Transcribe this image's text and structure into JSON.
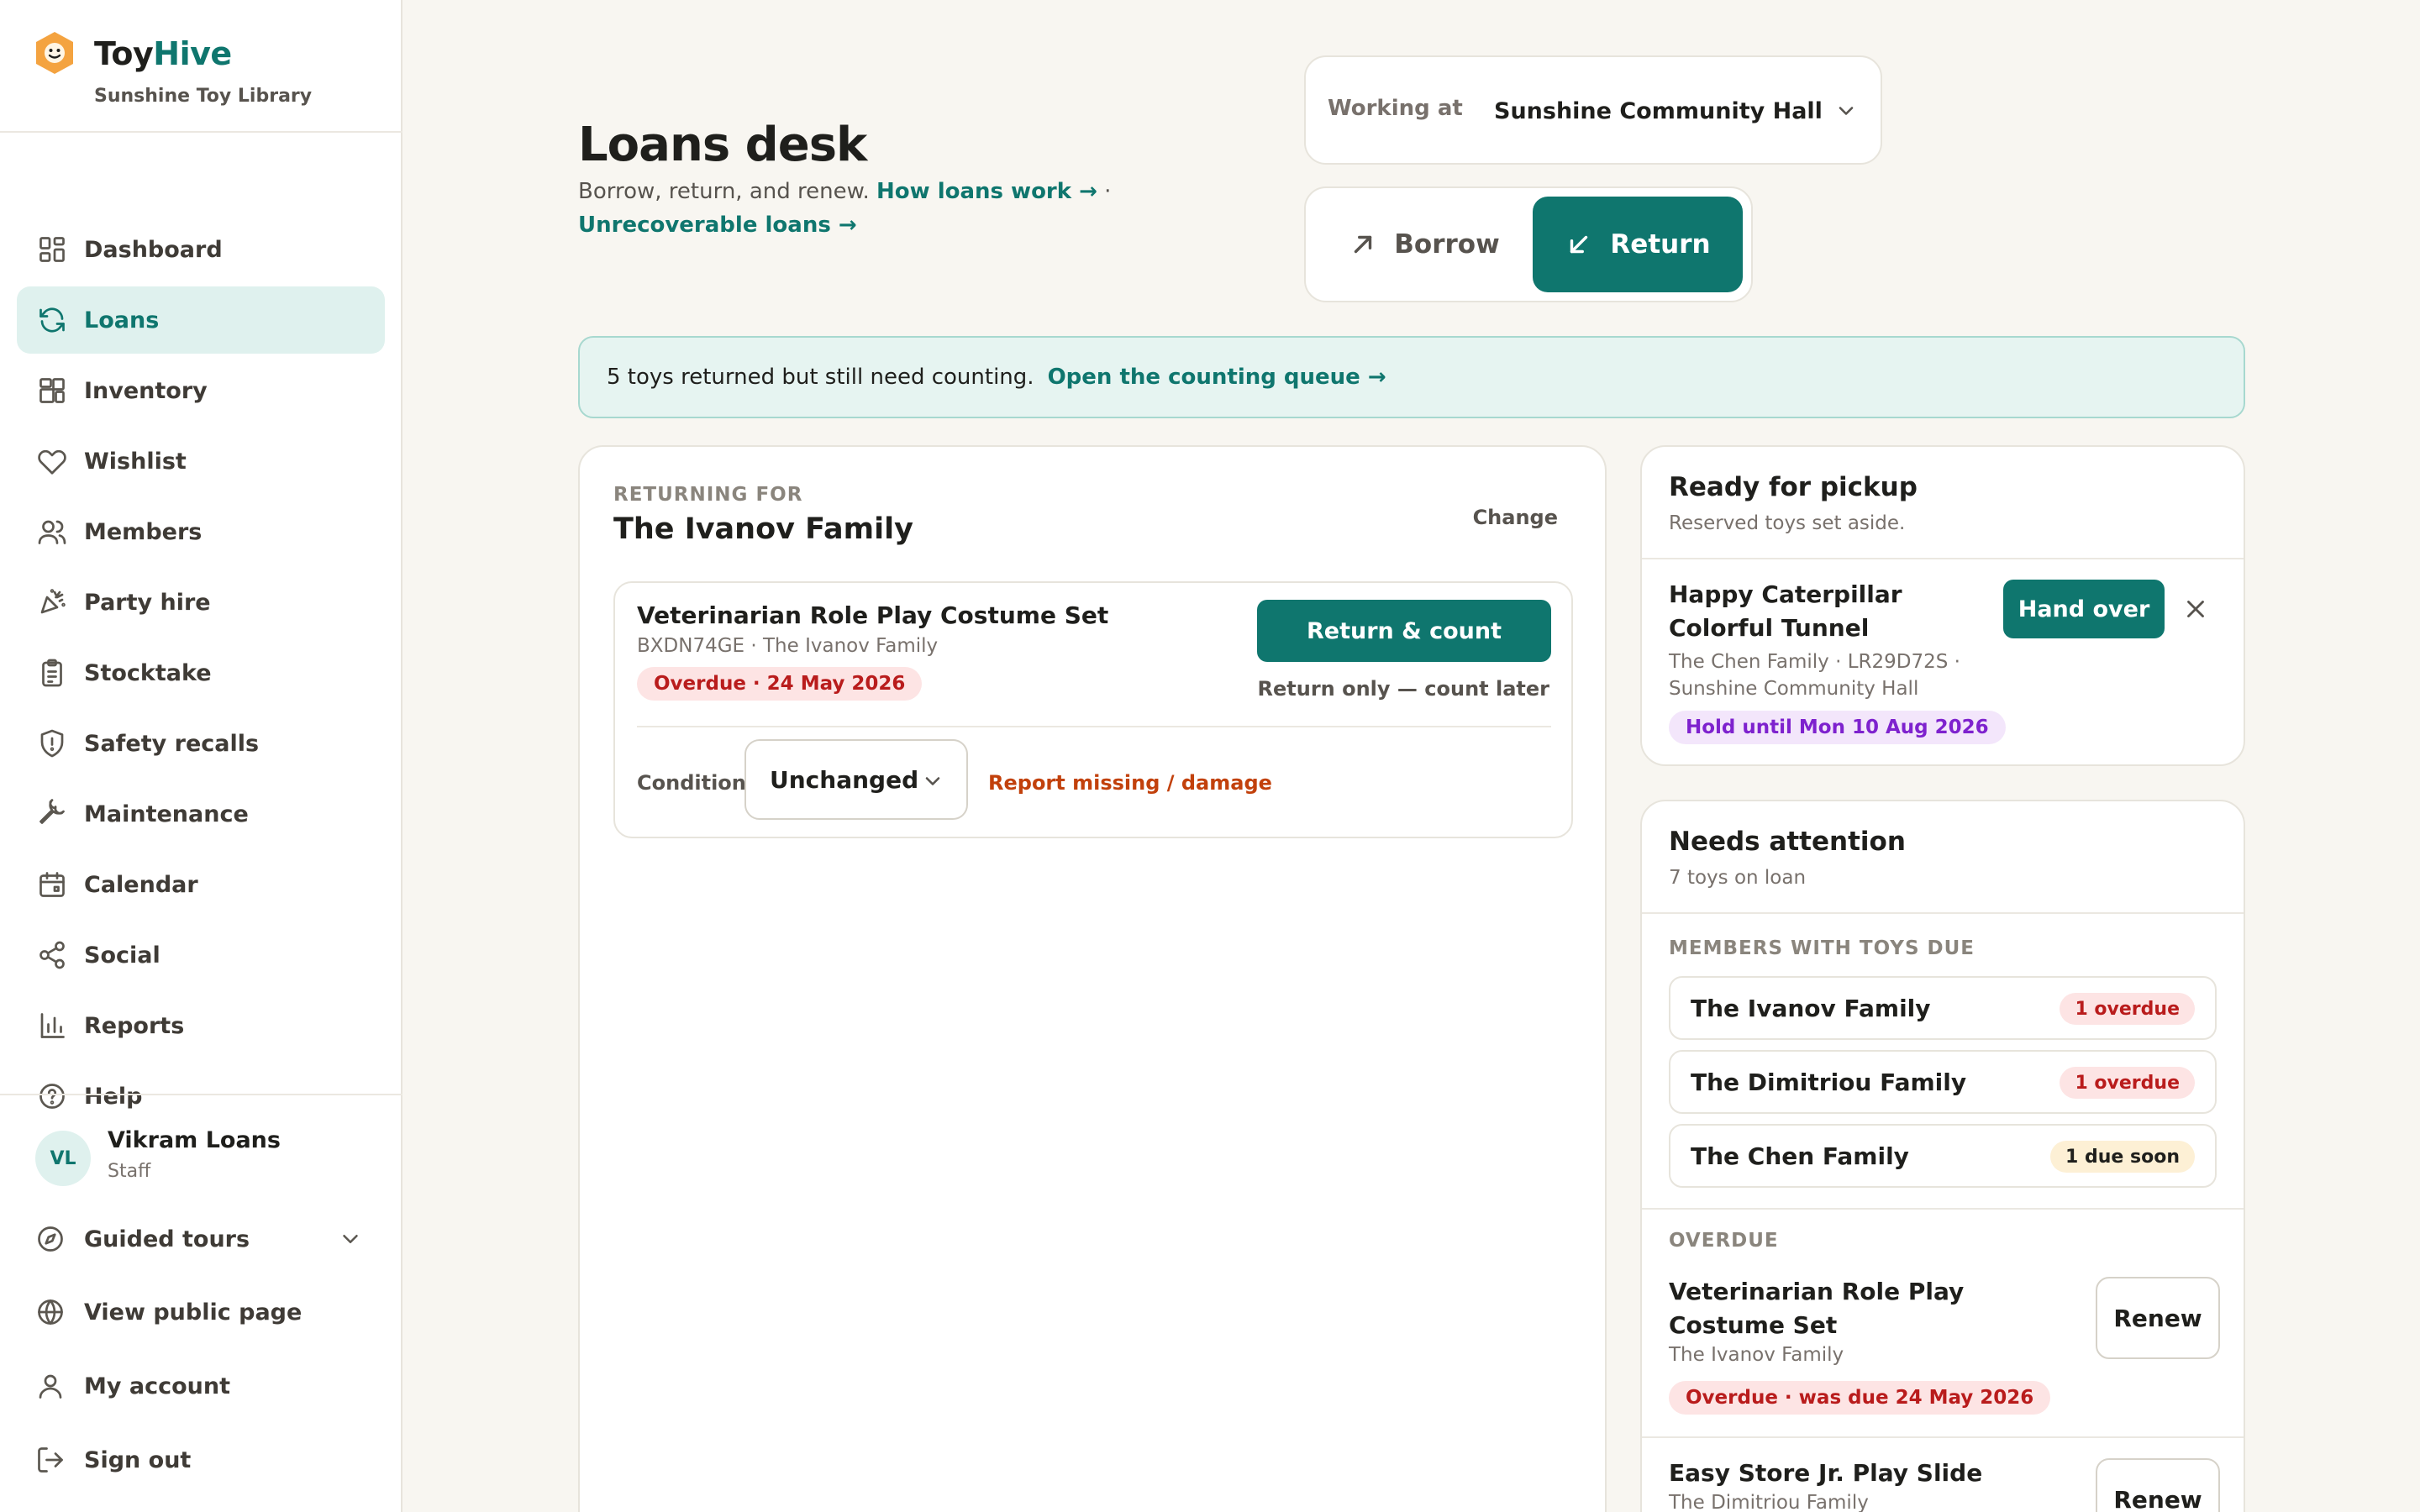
{
  "brand": {
    "name_part1": "Toy",
    "name_part2": "Hive",
    "library": "Sunshine Toy Library"
  },
  "nav": [
    {
      "label": "Dashboard",
      "icon": "dashboard-icon"
    },
    {
      "label": "Loans",
      "icon": "loans-icon",
      "active": true
    },
    {
      "label": "Inventory",
      "icon": "inventory-icon"
    },
    {
      "label": "Wishlist",
      "icon": "heart-icon"
    },
    {
      "label": "Members",
      "icon": "members-icon"
    },
    {
      "label": "Party hire",
      "icon": "party-icon"
    },
    {
      "label": "Stocktake",
      "icon": "clipboard-icon"
    },
    {
      "label": "Safety recalls",
      "icon": "shield-icon"
    },
    {
      "label": "Maintenance",
      "icon": "wrench-icon"
    },
    {
      "label": "Calendar",
      "icon": "calendar-icon"
    },
    {
      "label": "Social",
      "icon": "share-icon"
    },
    {
      "label": "Reports",
      "icon": "chart-icon"
    },
    {
      "label": "Help",
      "icon": "help-icon"
    }
  ],
  "user": {
    "initials": "VL",
    "name": "Vikram Loans",
    "role": "Staff"
  },
  "footer": {
    "guided_tours": "Guided tours",
    "public_page": "View public page",
    "account": "My account",
    "sign_out": "Sign out"
  },
  "header": {
    "title": "Loans desk",
    "subtitle": "Borrow, return, and renew.",
    "link1": "How loans work →",
    "separator": "·",
    "link2": "Unrecoverable loans →"
  },
  "working_at": {
    "label": "Working at",
    "value": "Sunshine Community Hall"
  },
  "mode": {
    "borrow": "Borrow",
    "return": "Return",
    "selected": "Return"
  },
  "banner": {
    "text": "5 toys returned but still need counting.",
    "link": "Open the counting queue →"
  },
  "returning": {
    "eyebrow": "RETURNING FOR",
    "member": "The Ivanov Family",
    "change": "Change",
    "loan": {
      "title": "Veterinarian Role Play Costume Set",
      "meta": "BXDN74GE · The Ivanov Family",
      "status": "Overdue · 24 May 2026",
      "primary": "Return & count",
      "secondary": "Return only — count later",
      "condition_label": "Condition",
      "condition_value": "Unchanged",
      "report": "Report missing / damage"
    }
  },
  "pickup": {
    "title": "Ready for pickup",
    "subtitle": "Reserved toys set aside.",
    "item": {
      "title": "Happy Caterpillar Colorful Tunnel",
      "meta": "The Chen Family · LR29D72S · Sunshine Community Hall",
      "hold": "Hold until Mon 10 Aug 2026",
      "action": "Hand over"
    }
  },
  "attention": {
    "title": "Needs attention",
    "subtitle": "7 toys on loan",
    "members_eyebrow": "MEMBERS WITH TOYS DUE",
    "members": [
      {
        "name": "The Ivanov Family",
        "status": "1 overdue",
        "tone": "red"
      },
      {
        "name": "The Dimitriou Family",
        "status": "1 overdue",
        "tone": "red"
      },
      {
        "name": "The Chen Family",
        "status": "1 due soon",
        "tone": "amber"
      }
    ],
    "overdue_eyebrow": "OVERDUE",
    "overdue": [
      {
        "title": "Veterinarian Role Play Costume Set",
        "member": "The Ivanov Family",
        "status": "Overdue · was due 24 May 2026",
        "action": "Renew"
      },
      {
        "title": "Easy Store Jr. Play Slide",
        "member": "The Dimitriou Family",
        "action": "Renew"
      }
    ]
  },
  "colors": {
    "accent": "#0f766e",
    "accent_soft": "#dff1ee",
    "danger": "#b91c1c",
    "warning": "#c2410c",
    "purple": "#7e22ce",
    "background": "#f8f6f1"
  }
}
